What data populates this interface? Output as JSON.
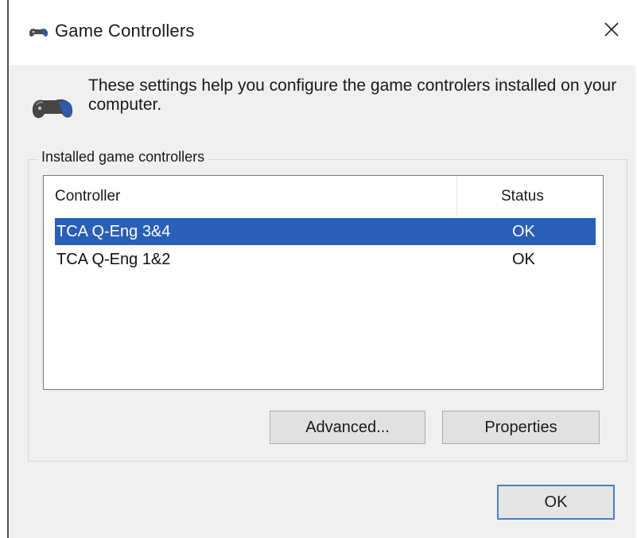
{
  "window": {
    "title": "Game Controllers",
    "title_icon": "gamepad-icon",
    "close_label": "×"
  },
  "intro": {
    "icon": "gamepad-icon",
    "text": "These settings help you configure the game controlers installed on your computer."
  },
  "group": {
    "label": "Installed game controllers"
  },
  "list": {
    "columns": [
      "Controller",
      "Status"
    ],
    "rows": [
      {
        "name": "TCA Q-Eng 3&4",
        "status": "OK",
        "selected": true
      },
      {
        "name": "TCA Q-Eng 1&2",
        "status": "OK",
        "selected": false
      }
    ],
    "selection_color": "#2a5fb8"
  },
  "buttons": {
    "advanced": "Advanced...",
    "properties": "Properties",
    "ok": "OK"
  }
}
